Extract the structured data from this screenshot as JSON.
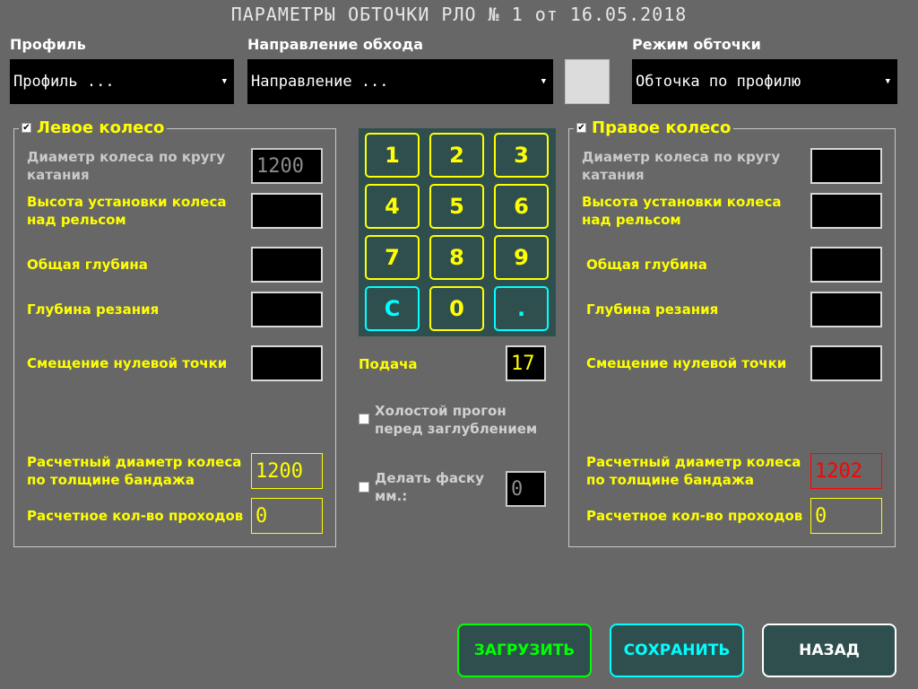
{
  "title": "ПАРАМЕТРЫ ОБТОЧКИ РЛО № 1 от 16.05.2018",
  "profile": {
    "label": "Профиль",
    "value": "Профиль ..."
  },
  "direction": {
    "label": "Направление обхода",
    "value": "Направление ..."
  },
  "mode": {
    "label": "Режим обточки",
    "value": "Обточка по профилю"
  },
  "left": {
    "title": "Левое колесо",
    "checked": true,
    "diameter_label": "Диаметр колеса по кругу катания",
    "diameter_value": "1200",
    "height_label": "Высота установки колеса над рельсом",
    "height_value": "",
    "depth_label": "Общая глубина",
    "depth_value": "",
    "cut_label": "Глубина резания",
    "cut_value": "",
    "offset_label": "Смещение нулевой точки",
    "offset_value": "",
    "calc_diam_label": "Расчетный диаметр колеса по толщине бандажа",
    "calc_diam_value": "1200",
    "passes_label": "Расчетное кол-во проходов",
    "passes_value": "0"
  },
  "right": {
    "title": "Правое колесо",
    "checked": true,
    "diameter_label": "Диаметр колеса по кругу катания",
    "diameter_value": "",
    "height_label": "Высота установки колеса над рельсом",
    "height_value": "",
    "depth_label": "Общая глубина",
    "depth_value": "",
    "cut_label": "Глубина резания",
    "cut_value": "",
    "offset_label": "Смещение нулевой точки",
    "offset_value": "",
    "calc_diam_label": "Расчетный диаметр колеса по толщине бандажа",
    "calc_diam_value": "1202",
    "passes_label": "Расчетное кол-во проходов",
    "passes_value": "0"
  },
  "keypad": {
    "k1": "1",
    "k2": "2",
    "k3": "3",
    "k4": "4",
    "k5": "5",
    "k6": "6",
    "k7": "7",
    "k8": "8",
    "k9": "9",
    "kc": "C",
    "k0": "0",
    "kdot": "."
  },
  "feed": {
    "label": "Подача",
    "value": "17"
  },
  "idle": {
    "label": "Холостой прогон перед заглублением",
    "checked": false
  },
  "chamfer": {
    "label": "Делать фаску мм.:",
    "checked": false,
    "value": "0"
  },
  "buttons": {
    "load": "ЗАГРУЗИТЬ",
    "save": "СОХРАНИТЬ",
    "back": "НАЗАД"
  },
  "colors": {
    "background": "#676767",
    "accent_yellow": "#ffff00",
    "accent_cyan": "#00ffff",
    "accent_green": "#00ff00",
    "alert_red": "#ff0000",
    "keypad_bg": "#2f4f4f"
  }
}
